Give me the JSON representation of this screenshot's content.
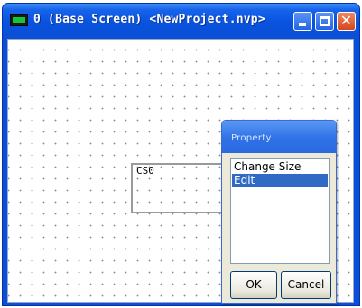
{
  "window": {
    "title": "0 (Base Screen) <NewProject.nvp>",
    "icon": "screen-icon",
    "controls": {
      "minimize": "minimize-icon",
      "maximize": "maximize-icon",
      "close": "close-icon",
      "close_glyph": "✕"
    }
  },
  "canvas": {
    "part_label": "CS0"
  },
  "dialog": {
    "title": "Property",
    "items": [
      {
        "label": "Change Size",
        "selected": false
      },
      {
        "label": "Edit",
        "selected": true
      }
    ],
    "ok_label": "OK",
    "cancel_label": "Cancel"
  },
  "colors": {
    "titlebar": "#0953e0",
    "selection": "#316ac5",
    "close_button": "#d2461f"
  }
}
